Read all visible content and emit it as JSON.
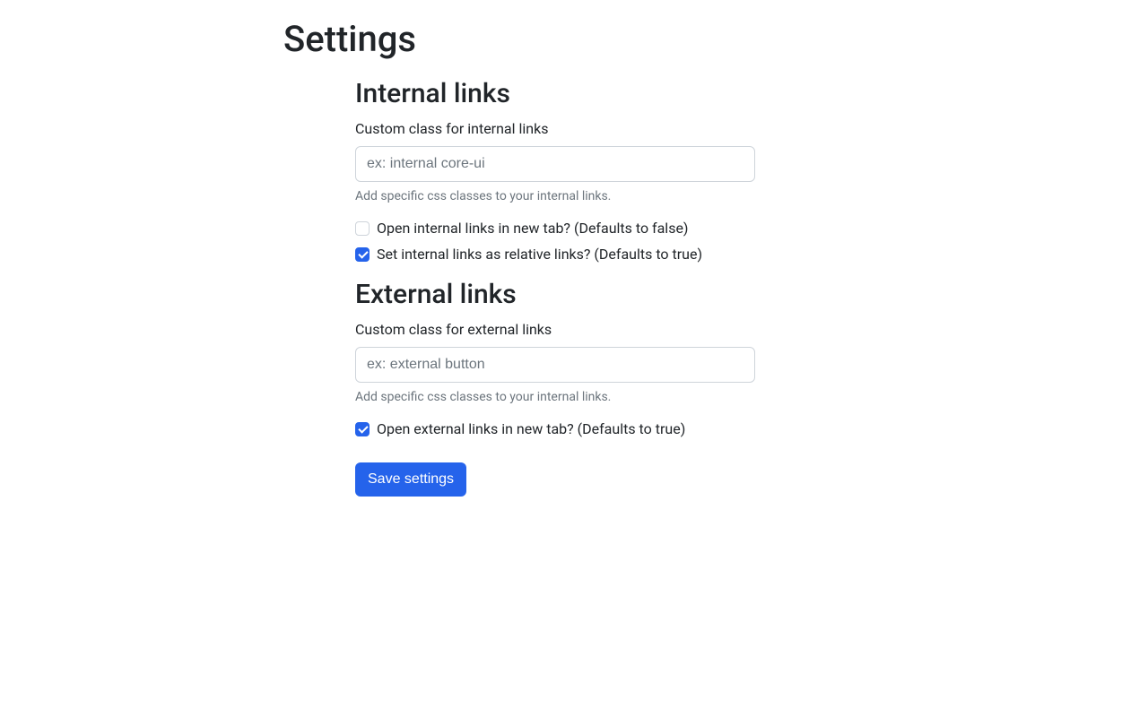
{
  "page": {
    "title": "Settings"
  },
  "internal": {
    "heading": "Internal links",
    "class_label": "Custom class for internal links",
    "class_placeholder": "ex: internal core-ui",
    "class_help": "Add specific css classes to your internal links.",
    "new_tab_label": "Open internal links in new tab? (Defaults to false)",
    "new_tab_checked": false,
    "relative_label": "Set internal links as relative links? (Defaults to true)",
    "relative_checked": true
  },
  "external": {
    "heading": "External links",
    "class_label": "Custom class for external links",
    "class_placeholder": "ex: external button",
    "class_help": "Add specific css classes to your internal links.",
    "new_tab_label": "Open external links in new tab? (Defaults to true)",
    "new_tab_checked": true
  },
  "actions": {
    "save_label": "Save settings"
  }
}
